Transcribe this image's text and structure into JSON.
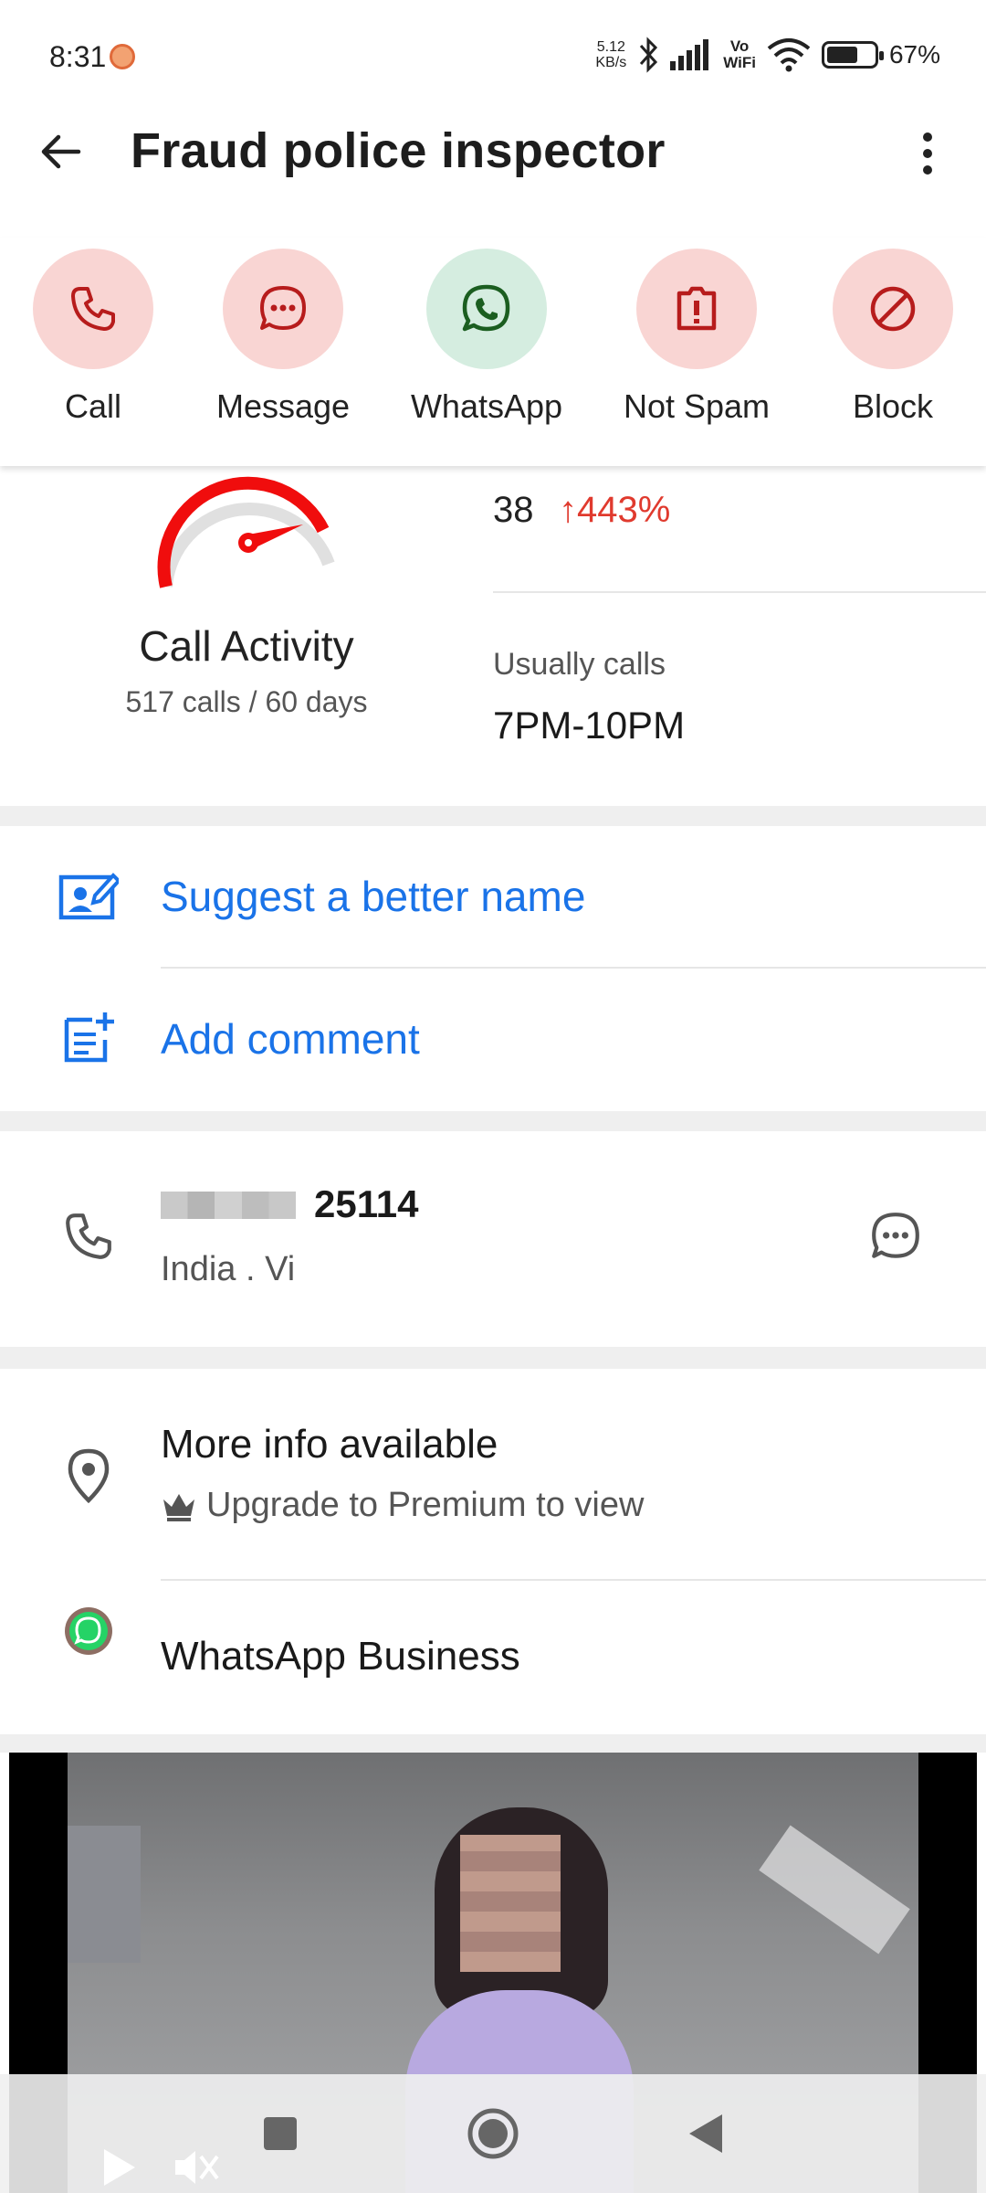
{
  "status_bar": {
    "time": "8:31",
    "net_speed_value": "5.12",
    "net_speed_unit": "KB/s",
    "vo": "Vo",
    "wifi_label": "WiFi",
    "battery_percent": "67%",
    "battery_level": 0.67
  },
  "header": {
    "title": "Fraud police inspector"
  },
  "actions": [
    {
      "label": "Call",
      "icon": "phone-icon"
    },
    {
      "label": "Message",
      "icon": "chat-bubble-icon"
    },
    {
      "label": "WhatsApp",
      "icon": "whatsapp-icon"
    },
    {
      "label": "Not Spam",
      "icon": "report-icon"
    },
    {
      "label": "Block",
      "icon": "block-icon"
    }
  ],
  "activity": {
    "title": "Call Activity",
    "subtitle": "517 calls / 60 days",
    "stat_value": "38",
    "stat_change": "↑443%",
    "usually_label": "Usually calls",
    "usually_value": "7PM-10PM"
  },
  "links": {
    "suggest": "Suggest a better name",
    "comment": "Add comment"
  },
  "phone": {
    "number_suffix": "25114",
    "carrier": "India . Vi"
  },
  "info": {
    "title": "More info available",
    "premium": "Upgrade to Premium to view",
    "whatsapp_business": "WhatsApp Business"
  },
  "colors": {
    "red_accent": "#c62828",
    "red_circle": "#f9d5d3",
    "green_accent": "#1b6b3a",
    "green_circle": "#d5ede0",
    "link_blue": "#1a73e8",
    "trend_red": "#e03a2e"
  }
}
